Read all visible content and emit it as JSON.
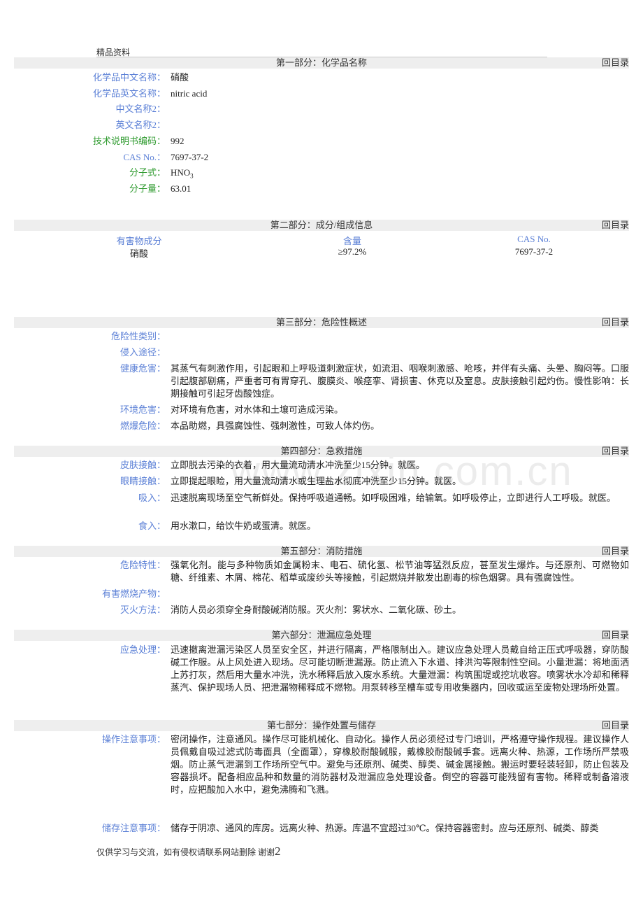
{
  "header_note": "精品资料",
  "toc_label": "回目录",
  "sections": {
    "s1": {
      "title": "第一部分：化学品名称",
      "fields": [
        {
          "label": "化学品中文名称：",
          "value": "硝酸"
        },
        {
          "label": "化学品英文名称：",
          "value": "nitric acid"
        },
        {
          "label": "中文名称2：",
          "value": ""
        },
        {
          "label": "英文名称2：",
          "value": ""
        },
        {
          "label": "技术说明书编码：",
          "value": "992"
        },
        {
          "label": "CAS No.：",
          "value": "7697-37-2"
        },
        {
          "label": "分子式：",
          "value_main": "HNO",
          "value_sub": "3"
        },
        {
          "label": "分子量：",
          "value": "63.01"
        }
      ]
    },
    "s2": {
      "title": "第二部分：成分/组成信息",
      "headers": [
        "有害物成分",
        "含量",
        "CAS No."
      ],
      "rows": [
        [
          "硝酸",
          "≥97.2%",
          "7697-37-2"
        ]
      ]
    },
    "s3": {
      "title": "第三部分：危险性概述",
      "fields": [
        {
          "label": "危险性类别：",
          "value": ""
        },
        {
          "label": "侵入途径：",
          "value": ""
        },
        {
          "label": "健康危害：",
          "value": "其蒸气有刺激作用，引起眼和上呼吸道刺激症状，如流泪、咽喉刺激感、呛咳，并伴有头痛、头晕、胸闷等。口服引起腹部剧痛，严重者可有胃穿孔、腹膜炎、喉痉挛、肾损害、休克以及窒息。皮肤接触引起灼伤。慢性影响：长期接触可引起牙齿酸蚀症。"
        },
        {
          "label": "环境危害：",
          "value": "对环境有危害，对水体和土壤可造成污染。"
        },
        {
          "label": "燃爆危险：",
          "value": "本品助燃，具强腐蚀性、强刺激性，可致人体灼伤。"
        }
      ]
    },
    "s4": {
      "title": "第四部分：急救措施",
      "fields": [
        {
          "label": "皮肤接触：",
          "value": "立即脱去污染的衣着，用大量流动清水冲洗至少15分钟。就医。"
        },
        {
          "label": "眼睛接触：",
          "value": "立即提起眼睑，用大量流动清水或生理盐水彻底冲洗至少15分钟。就医。"
        },
        {
          "label": "吸入：",
          "value": "迅速脱离现场至空气新鲜处。保持呼吸道通畅。如呼吸困难，给输氧。如呼吸停止，立即进行人工呼吸。就医。"
        },
        {
          "label": "食入：",
          "value": "用水漱口，给饮牛奶或蛋清。就医。"
        }
      ]
    },
    "s5": {
      "title": "第五部分：消防措施",
      "fields": [
        {
          "label": "危险特性：",
          "value": "强氧化剂。能与多种物质如金属粉末、电石、硫化氢、松节油等猛烈反应，甚至发生爆炸。与还原剂、可燃物如糖、纤维素、木屑、棉花、稻草或废纱头等接触，引起燃烧并散发出剧毒的棕色烟雾。具有强腐蚀性。"
        },
        {
          "label": "有害燃烧产物：",
          "value": ""
        },
        {
          "label": "灭火方法：",
          "value": "消防人员必须穿全身耐酸碱消防服。灭火剂：雾状水、二氧化碳、砂土。"
        }
      ]
    },
    "s6": {
      "title": "第六部分：泄漏应急处理",
      "fields": [
        {
          "label": "应急处理：",
          "value": "迅速撤离泄漏污染区人员至安全区，并进行隔离，严格限制出入。建议应急处理人员戴自给正压式呼吸器，穿防酸碱工作服。从上风处进入现场。尽可能切断泄漏源。防止流入下水道、排洪沟等限制性空间。小量泄漏：将地面洒上苏打灰，然后用大量水冲洗，洗水稀释后放入废水系统。大量泄漏：构筑围堤或挖坑收容。喷雾状水冷却和稀释蒸汽、保护现场人员、把泄漏物稀释成不燃物。用泵转移至槽车或专用收集器内，回收或运至废物处理场所处置。"
        }
      ]
    },
    "s7": {
      "title": "第七部分：操作处置与储存",
      "fields": [
        {
          "label": "操作注意事项：",
          "value": "密闭操作，注意通风。操作尽可能机械化、自动化。操作人员必须经过专门培训，严格遵守操作规程。建议操作人员佩戴自吸过滤式防毒面具（全面罩），穿橡胶耐酸碱服，戴橡胶耐酸碱手套。远离火种、热源，工作场所严禁吸烟。防止蒸气泄漏到工作场所空气中。避免与还原剂、碱类、醇类、碱金属接触。搬运时要轻装轻卸，防止包装及容器损坏。配备相应品种和数量的消防器材及泄漏应急处理设备。倒空的容器可能残留有害物。稀释或制备溶液时，应把酸加入水中，避免沸腾和飞溅。"
        },
        {
          "label": "储存注意事项：",
          "value": "储存于阴凉、通风的库房。远离火种、热源。库温不宜超过30℃。保持容器密封。应与还原剂、碱类、醇类"
        }
      ]
    }
  },
  "watermark": "www.zixin.com.cn",
  "footer": {
    "text": "仅供学习与交流，如有侵权请联系网站删除 谢谢",
    "page_number": "2"
  }
}
